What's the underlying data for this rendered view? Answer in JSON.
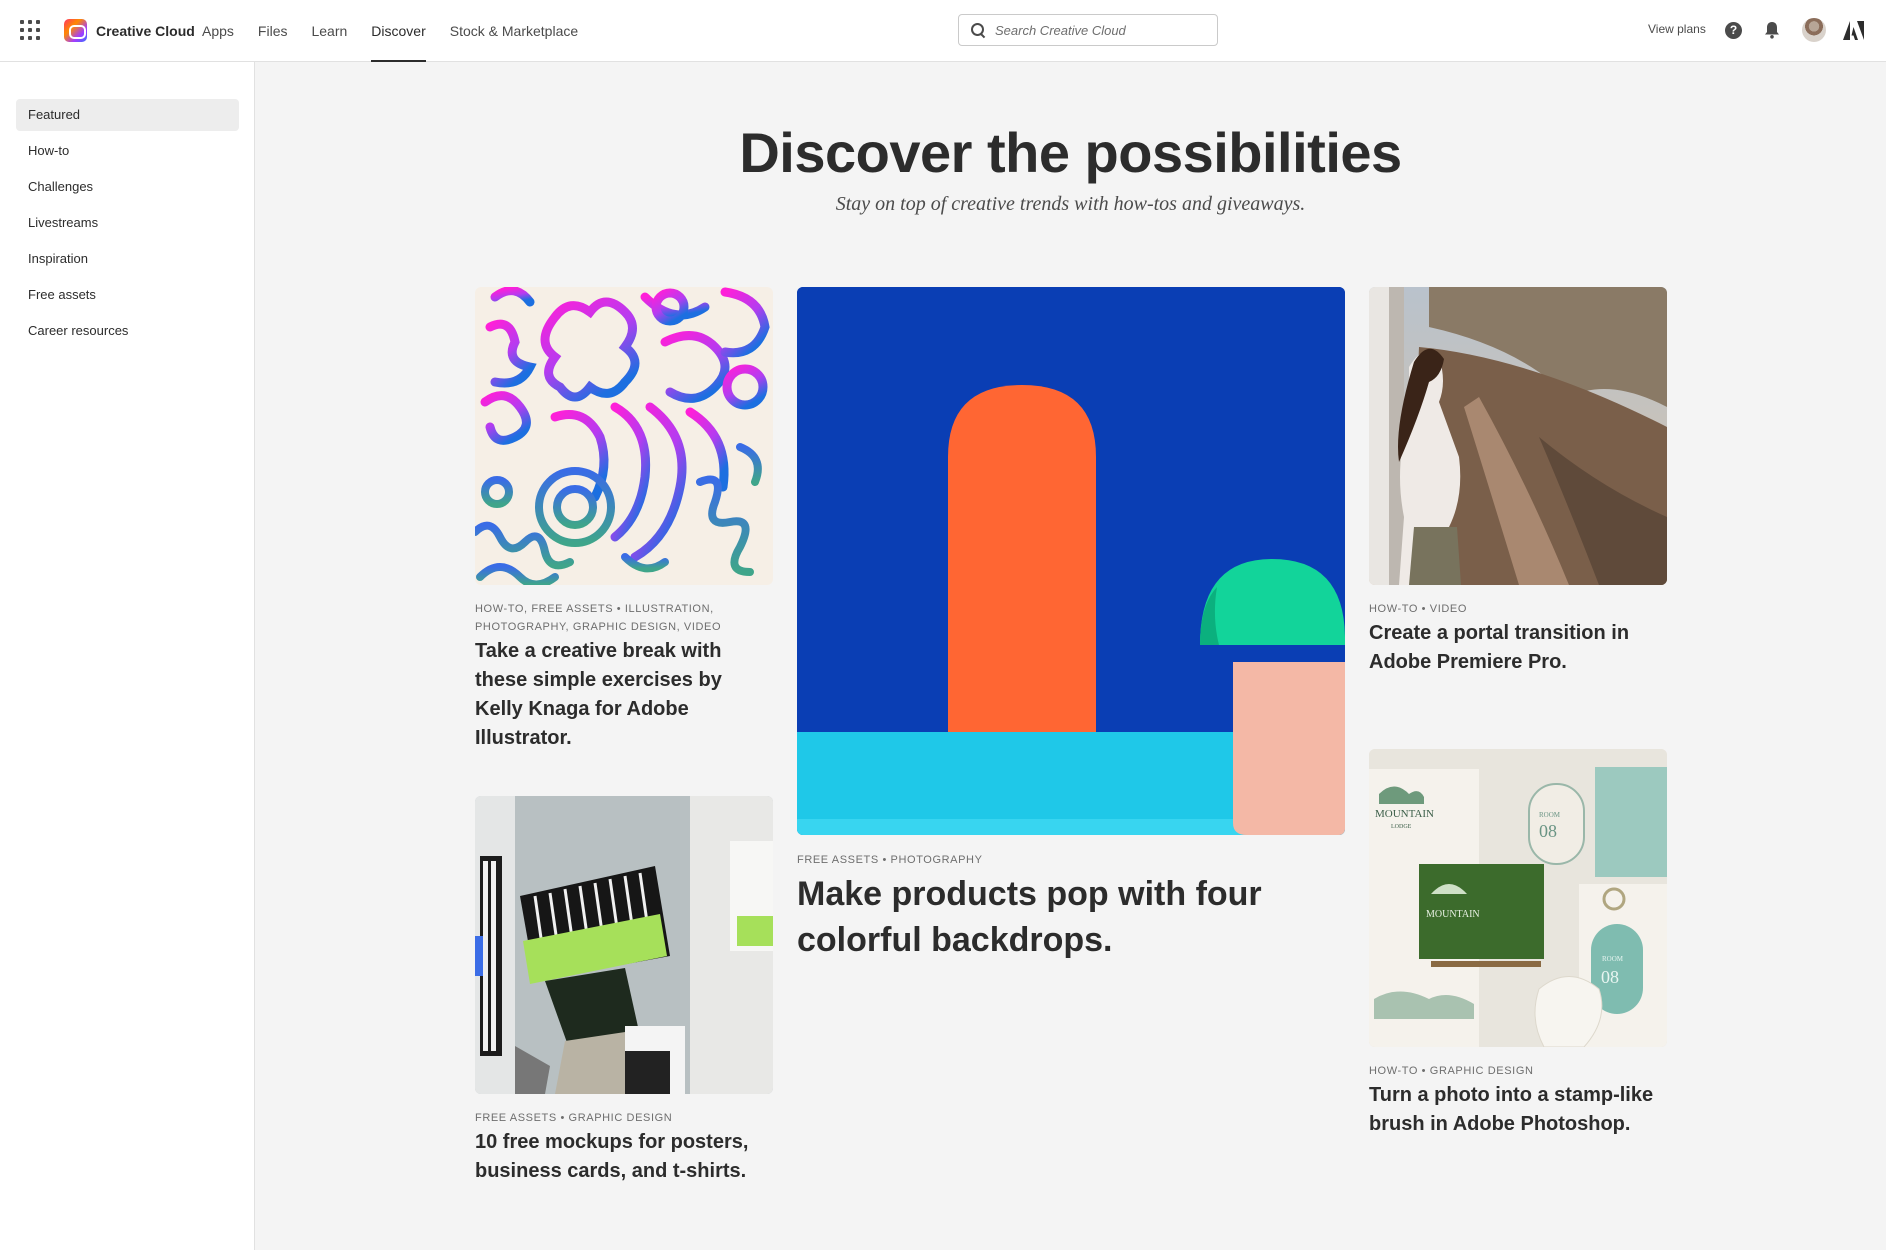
{
  "topbar": {
    "brand": "Creative Cloud",
    "nav": [
      "Apps",
      "Files",
      "Learn",
      "Discover",
      "Stock & Marketplace"
    ],
    "active_nav": "Discover",
    "search_placeholder": "Search Creative Cloud",
    "view_plans": "View plans",
    "help_glyph": "?"
  },
  "sidebar": {
    "items": [
      "Featured",
      "How-to",
      "Challenges",
      "Livestreams",
      "Inspiration",
      "Free assets",
      "Career resources"
    ],
    "active": "Featured"
  },
  "hero": {
    "title": "Discover the possibilities",
    "subtitle": "Stay on top of creative trends with how-tos and giveaways."
  },
  "cards": [
    {
      "tags": "How-to, Free assets • Illustration, Photography, Graphic design, Video",
      "title": "Take a creative break with these simple exercises by Kelly Knaga for Adobe Illustrator.",
      "image": "colorful-line-pattern"
    },
    {
      "tags": "Free assets • Photography",
      "title": "Make products pop with four colorful backdrops.",
      "image": "colorful-backdrop-shapes"
    },
    {
      "tags": "How-to • Video",
      "title": "Create a portal transition in Adobe Premiere Pro.",
      "image": "woman-on-mountain-path"
    },
    {
      "tags": "Free assets • Graphic design",
      "title": "10 free mockups for posters, business cards, and t-shirts.",
      "image": "poster-mockup-photo"
    },
    {
      "tags": "How-to • Graphic design",
      "title": "Turn a photo into a stamp-like brush in Adobe Photoshop.",
      "image": "mountain-lodge-branding"
    }
  ],
  "mockup_texts": {
    "lodge": "MOUNTAIN",
    "lodge_sub": "LODGE",
    "room": "ROOM",
    "room_no": "08"
  },
  "colors": {
    "accent_nav_underline": "#2c2c2c",
    "page_bg": "#f4f4f4",
    "backdrop_blue": "#0a3eb4",
    "backdrop_orange": "#ff6633",
    "backdrop_cyan": "#1fc8e8",
    "backdrop_green": "#12d49a"
  },
  "icons": [
    "app-grid-icon",
    "creative-cloud-logo",
    "search-icon",
    "help-icon",
    "bell-icon",
    "avatar",
    "adobe-logo-icon"
  ]
}
